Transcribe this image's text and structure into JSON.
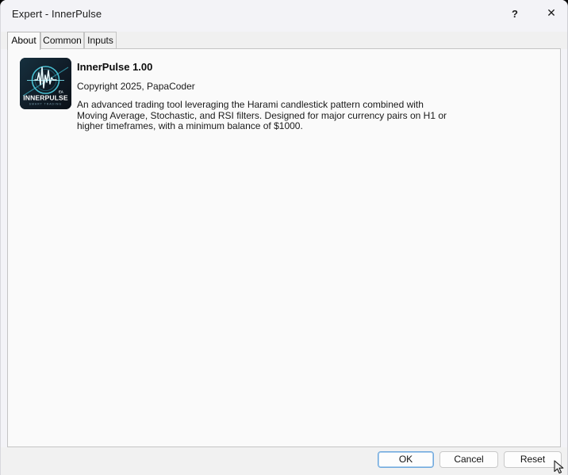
{
  "window": {
    "title": "Expert - InnerPulse",
    "help_label": "?",
    "close_label": "✕",
    "help_icon": "question-mark-icon",
    "close_icon": "close-x-icon"
  },
  "tabs": [
    {
      "label": "About",
      "active": true
    },
    {
      "label": "Common",
      "active": false
    },
    {
      "label": "Inputs",
      "active": false
    }
  ],
  "about": {
    "logo_alt": "InnerPulse EA logo",
    "logo_brand": "INNERPULSE",
    "logo_badge": "EA",
    "logo_tagline": "SMART TRADING",
    "title": "InnerPulse 1.00",
    "copyright": "Copyright 2025, PapaCoder",
    "description": "An advanced trading tool leveraging the Harami candlestick pattern combined with Moving Average, Stochastic, and RSI filters. Designed for major currency pairs on H1 or higher timeframes, with a minimum balance of $1000."
  },
  "footer": {
    "ok_label": "OK",
    "cancel_label": "Cancel",
    "reset_label": "Reset"
  },
  "colors": {
    "window_background": "#f3f3f7",
    "content_background": "#fafafa",
    "tab_strip": "#f0f0f0",
    "border": "#c4c4c4",
    "default_button_outline": "#6ea8dd",
    "logo_accent": "#35c8d8",
    "logo_background": "#0f1b26",
    "text": "#1a1a1a"
  }
}
